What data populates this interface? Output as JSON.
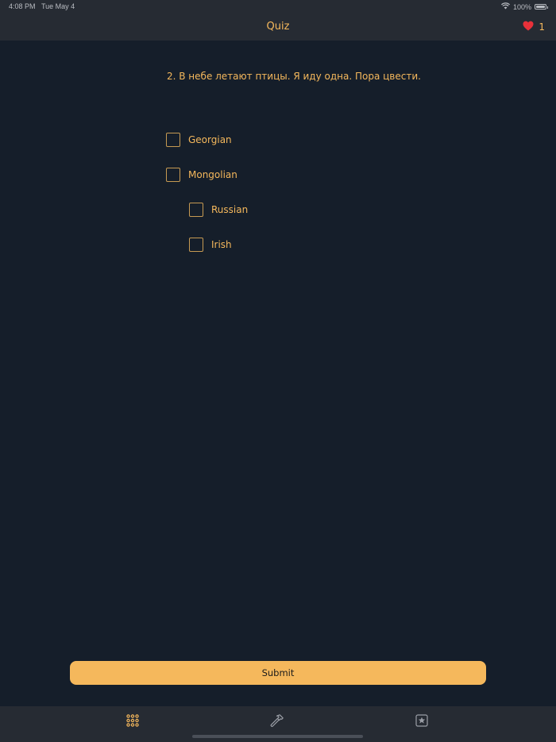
{
  "status_bar": {
    "time": "4:08 PM",
    "date": "Tue May 4",
    "battery": "100%"
  },
  "nav": {
    "title": "Quiz",
    "lives": "1"
  },
  "question": "2. В небе летают птицы. Я иду одна. Пора цвести.",
  "options": [
    {
      "label": "Georgian",
      "checked": false
    },
    {
      "label": "Mongolian",
      "checked": false
    },
    {
      "label": "Russian",
      "checked": false
    },
    {
      "label": "Irish",
      "checked": false
    }
  ],
  "submit_label": "Submit",
  "tabs": [
    {
      "icon": "grid-icon"
    },
    {
      "icon": "hammer-icon"
    },
    {
      "icon": "star-square-icon"
    }
  ],
  "colors": {
    "accent": "#f5b85c",
    "background": "#151e2a",
    "bar": "#262b33"
  }
}
